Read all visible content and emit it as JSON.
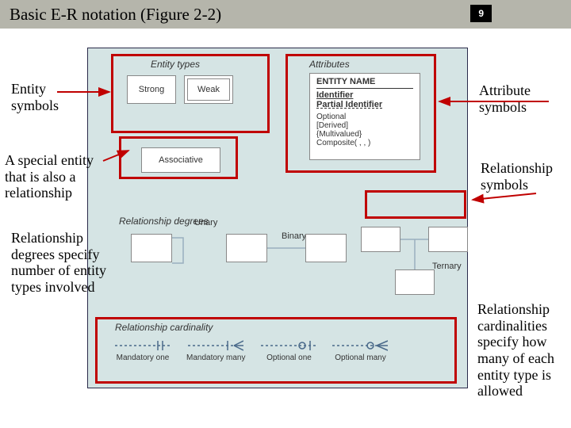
{
  "header": {
    "title": "Basic E-R notation (Figure 2-2)",
    "page_number": "9"
  },
  "labels": {
    "entity_symbols": "Entity symbols",
    "attribute_symbols": "Attribute symbols",
    "special_entity": "A special entity that is also a relationship",
    "rel_symbols": "Relationship symbols",
    "rel_degrees": "Relationship degrees specify number of entity types involved",
    "rel_cardinalities": "Relationship cardinalities specify how many of each entity type is allowed"
  },
  "sections": {
    "entity_types": "Entity types",
    "attributes": "Attributes",
    "strong": "Strong",
    "weak": "Weak",
    "associative": "Associative",
    "relationship_degrees": "Relationship degrees",
    "relationship_cardinality": "Relationship cardinality",
    "unary": "Unary",
    "binary": "Binary",
    "ternary": "Ternary"
  },
  "attr_box": {
    "entity_name": "ENTITY NAME",
    "identifier": "Identifier",
    "partial_identifier": "Partial Identifier",
    "optional": "Optional",
    "derived": "[Derived]",
    "multivalued": "{Multivalued}",
    "composite": "Composite( , , )"
  },
  "cardinality": {
    "mandatory_one": "Mandatory one",
    "mandatory_many": "Mandatory many",
    "optional_one": "Optional one",
    "optional_many": "Optional many"
  }
}
